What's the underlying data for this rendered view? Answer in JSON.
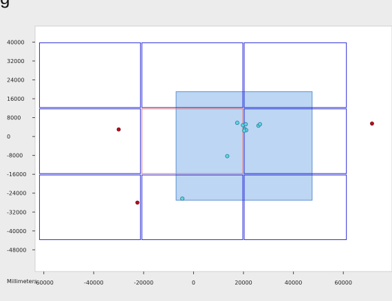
{
  "title_fragment": "g",
  "x_axis_unit_label": "Millimeters",
  "colors": {
    "background": "#ececec",
    "plot_background": "#ffffff",
    "grid_border": "#2a2ad6",
    "selected_cell_border": "#e87878",
    "overlay_fill": "#a9cbf0",
    "overlay_border": "#5d8fcf",
    "outside_point": "#b01020",
    "inside_point": "#5fd4e8"
  },
  "chart_data": {
    "type": "scatter",
    "x_ticks": [
      -60000,
      -40000,
      -20000,
      0,
      20000,
      40000,
      60000
    ],
    "y_ticks": [
      40000,
      32000,
      24000,
      16000,
      8000,
      0,
      -8000,
      -16000,
      -24000,
      -32000,
      -40000,
      -48000
    ],
    "x_tick_labels": [
      "-60000",
      "-40000",
      "-20000",
      "0",
      "20000",
      "40000",
      "60000"
    ],
    "y_tick_labels": [
      "40000",
      "32000",
      "24000",
      "16000",
      "8000",
      "0",
      "-8000",
      "-16000",
      "-24000",
      "-32000",
      "-40000",
      "-48000"
    ],
    "xlim": [
      -63500,
      79500
    ],
    "ylim": [
      -57200,
      46800
    ],
    "grid_cells": [
      {
        "x": [
          -62000,
          -21000
        ],
        "y": [
          12000,
          40000
        ]
      },
      {
        "x": [
          -21000,
          20000
        ],
        "y": [
          12000,
          40000
        ]
      },
      {
        "x": [
          20000,
          61500
        ],
        "y": [
          12000,
          40000
        ]
      },
      {
        "x": [
          -62000,
          -21000
        ],
        "y": [
          -16000,
          12000
        ]
      },
      {
        "x": [
          -21000,
          20000
        ],
        "y": [
          -16000,
          12000
        ],
        "selected": true
      },
      {
        "x": [
          20000,
          61500
        ],
        "y": [
          -16000,
          12000
        ]
      },
      {
        "x": [
          -62000,
          -21000
        ],
        "y": [
          -44000,
          -16000
        ]
      },
      {
        "x": [
          -21000,
          20000
        ],
        "y": [
          -44000,
          -16000
        ]
      },
      {
        "x": [
          20000,
          61500
        ],
        "y": [
          -44000,
          -16000
        ]
      }
    ],
    "overlay_rect": {
      "x": [
        -7000,
        47500
      ],
      "y": [
        -27000,
        19000
      ]
    },
    "outside_points": [
      {
        "x": -30000,
        "y": 3000
      },
      {
        "x": -22500,
        "y": -28000
      },
      {
        "x": 71500,
        "y": 5500
      }
    ],
    "inside_points": [
      {
        "x": 17500,
        "y": 5800
      },
      {
        "x": 19800,
        "y": 4800
      },
      {
        "x": 20900,
        "y": 5200
      },
      {
        "x": 20500,
        "y": 3200
      },
      {
        "x": 21100,
        "y": 2700
      },
      {
        "x": 20300,
        "y": 2500
      },
      {
        "x": 26000,
        "y": 4600
      },
      {
        "x": 26600,
        "y": 5200
      },
      {
        "x": 13500,
        "y": -8300
      },
      {
        "x": -4500,
        "y": -26300
      }
    ]
  }
}
